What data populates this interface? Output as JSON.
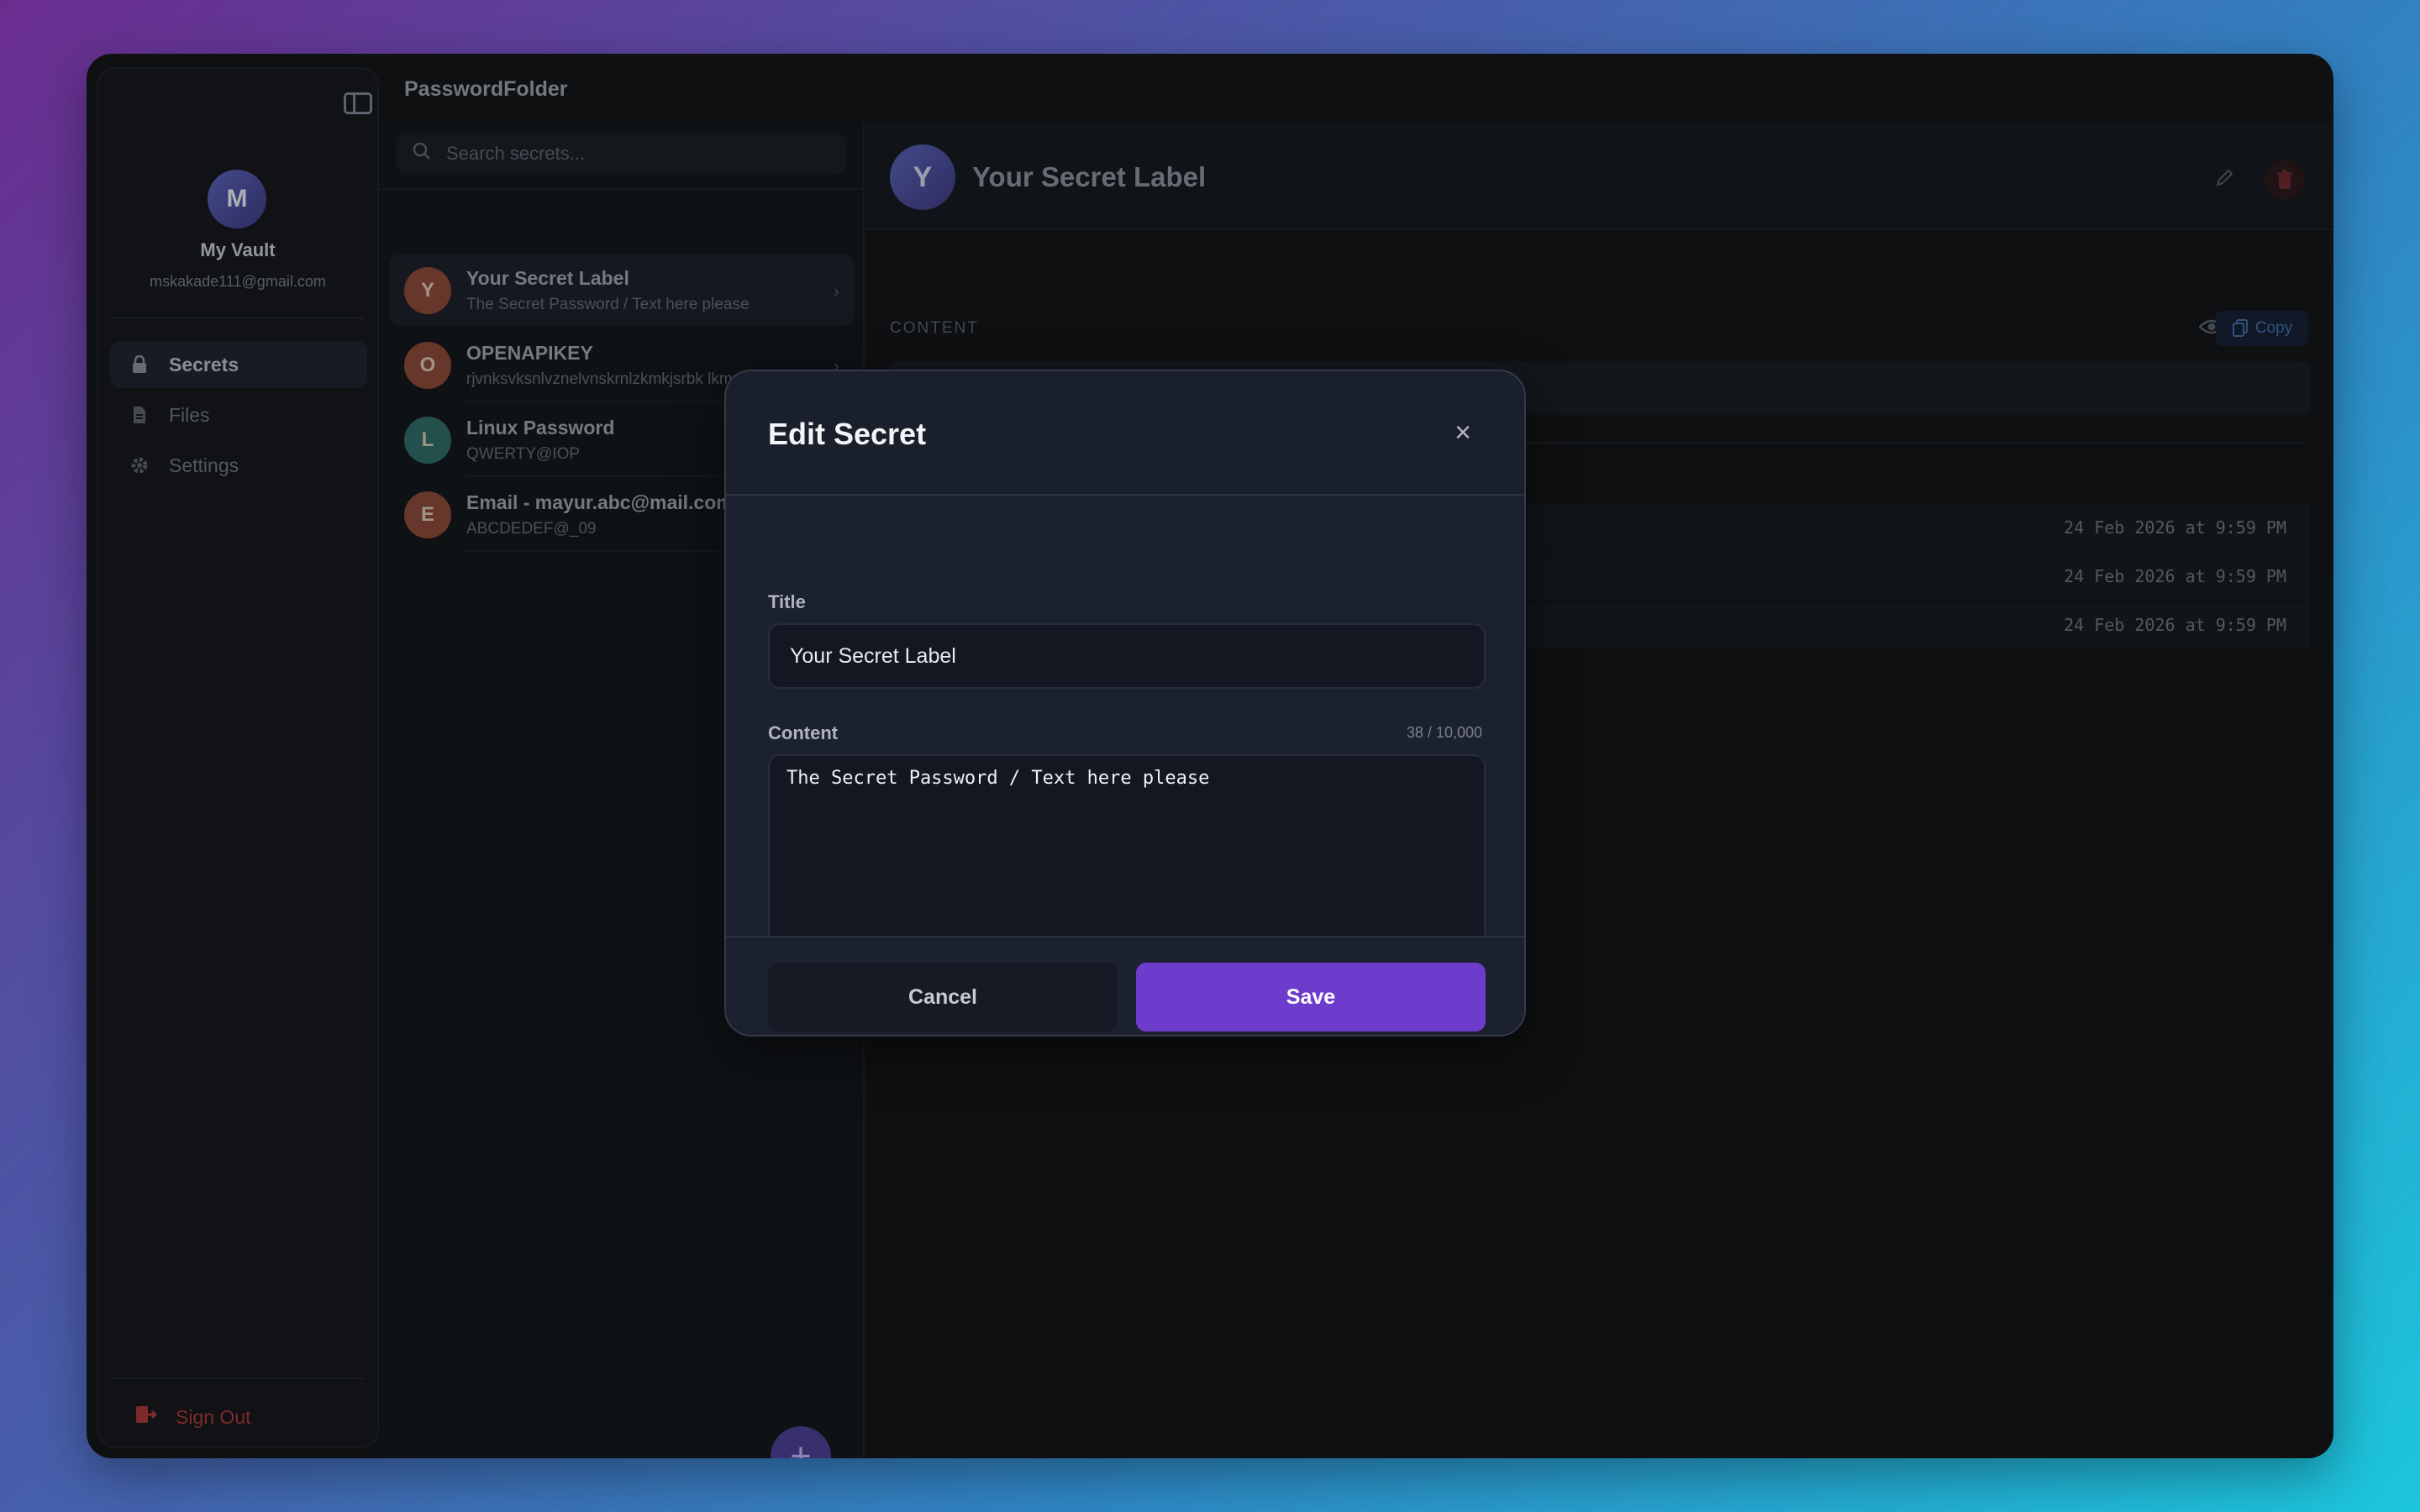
{
  "app": {
    "title": "PasswordFolder"
  },
  "sidebar": {
    "avatar_letter": "M",
    "vault_name": "My Vault",
    "email": "mskakade111@gmail.com",
    "items": [
      {
        "label": "Secrets",
        "icon": "lock-icon",
        "active": true
      },
      {
        "label": "Files",
        "icon": "file-icon",
        "active": false
      },
      {
        "label": "Settings",
        "icon": "gear-icon",
        "active": false
      }
    ],
    "sign_out": "Sign Out"
  },
  "list": {
    "search_placeholder": "Search secrets...",
    "items": [
      {
        "letter": "Y",
        "title": "Your Secret Label",
        "subtitle": "The Secret Password / Text here please",
        "color": "#8a4a3a",
        "active": true
      },
      {
        "letter": "O",
        "title": "OPENAPIKEY",
        "subtitle": "rjvnksvksnlvznelvnskrnlzkmkjsrbk lkmz...",
        "color": "#8a4a3a",
        "active": false
      },
      {
        "letter": "L",
        "title": "Linux Password",
        "subtitle": "QWERTY@IOP",
        "color": "#2f6b66",
        "active": false
      },
      {
        "letter": "E",
        "title": "Email - mayur.abc@mail.com",
        "subtitle": "ABCDEDEF@_09",
        "color": "#8a4a3a",
        "active": false
      }
    ],
    "add_label": "+"
  },
  "detail": {
    "avatar_letter": "Y",
    "title": "Your Secret Label",
    "content_label": "CONTENT",
    "copy_label": "Copy",
    "masked_value": "••••••••••••••••••••••••••••••••••••••",
    "timestamps": [
      "24 Feb 2026 at 9:59 PM",
      "24 Feb 2026 at 9:59 PM",
      "24 Feb 2026 at 9:59 PM"
    ]
  },
  "modal": {
    "title": "Edit Secret",
    "close_label": "×",
    "title_label": "Title",
    "title_value": "Your Secret Label",
    "content_label": "Content",
    "char_count": "38 / 10,000",
    "content_value": "The Secret Password / Text here please",
    "cancel_label": "Cancel",
    "save_label": "Save"
  },
  "colors": {
    "accent": "#6d3ccc",
    "danger": "#a83838",
    "copy": "#3f6fa8"
  }
}
